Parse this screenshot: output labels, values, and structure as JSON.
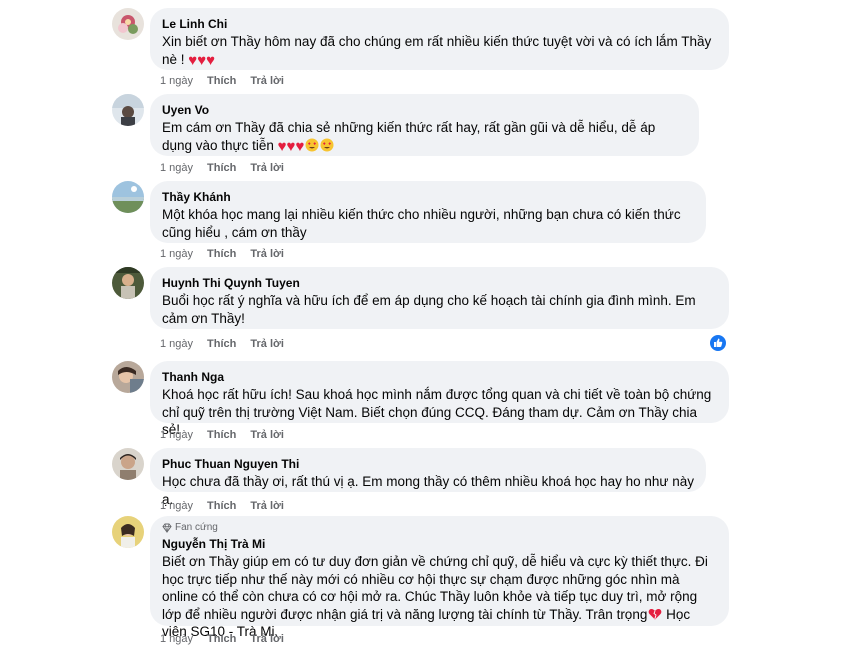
{
  "comments": [
    {
      "author": "Le Linh Chi",
      "text": "Xin biết ơn Thầy hôm nay đã cho chúng em rất nhiều kiến thức tuyệt vời và có ích lắm Thầy nè !",
      "time": "1 ngày",
      "like": "Thích",
      "reply": "Trả lời",
      "emojis": [
        "red-heart",
        "red-heart",
        "red-heart"
      ]
    },
    {
      "author": "Uyen Vo",
      "text": "Em cám ơn Thầy đã chia sẻ những kiến thức rất hay, rất gần gũi và dễ hiểu, dễ áp dụng vào thực tiễn",
      "time": "1 ngày",
      "like": "Thích",
      "reply": "Trả lời",
      "emojis": [
        "red-heart",
        "red-heart",
        "red-heart",
        "heart-eyes",
        "heart-eyes"
      ]
    },
    {
      "author": "Thầy Khánh",
      "text": "Một khóa học mang lại nhiều kiến thức cho nhiều người, những bạn chưa có kiến thức cũng hiểu , cám ơn thầy",
      "time": "1 ngày",
      "like": "Thích",
      "reply": "Trả lời"
    },
    {
      "author": "Huynh Thi Quynh Tuyen",
      "text": "Buổi học rất ý nghĩa và hữu ích để em áp dụng cho kế hoạch tài chính gia đình mình. Em cảm ơn Thầy!",
      "time": "1 ngày",
      "like": "Thích",
      "reply": "Trả lời",
      "reaction": "like"
    },
    {
      "author": "Thanh Nga",
      "text": "Khoá học rất hữu ích! Sau khoá học mình nắm được tổng quan và chi tiết về toàn bộ chứng chỉ quỹ trên thị trường Việt Nam. Biết chọn đúng CCQ. Đáng tham dự. Cảm ơn Thầy chia sẻ!",
      "time": "1 ngày",
      "like": "Thích",
      "reply": "Trả lời"
    },
    {
      "author": "Phuc Thuan Nguyen Thi",
      "text": "Học chưa đã thầy ơi, rất thú vị ạ. Em mong thầy có thêm nhiều khoá học hay ho như này ạ.",
      "time": "1 ngày",
      "like": "Thích",
      "reply": "Trả lời"
    },
    {
      "badge": "Fan cứng",
      "author": "Nguyễn Thị Trà Mi",
      "text": "Biết ơn Thầy giúp em có tư duy đơn giản về chứng chỉ quỹ, dễ hiểu và cực kỳ thiết thực. Đi học trực tiếp như thế này mới có nhiều cơ hội thực sự chạm được những góc nhìn mà online có thể còn chưa có cơ hội mở ra. Chúc Thầy luôn khỏe và tiếp tục duy trì, mở rộng lớp để nhiều người được nhận giá trị và năng lượng tài chính từ Thầy. Trân trọng",
      "text_tail": " Học viên SG10 - Trà Mi.",
      "time": "1 ngày",
      "like": "Thích",
      "reply": "Trả lời",
      "emojis": [
        "broken-heart"
      ]
    }
  ],
  "colors": {
    "bubble": "#f0f2f5",
    "meta": "#65676b",
    "heart": "#e41e3f",
    "like_blue": "#1877f2"
  }
}
